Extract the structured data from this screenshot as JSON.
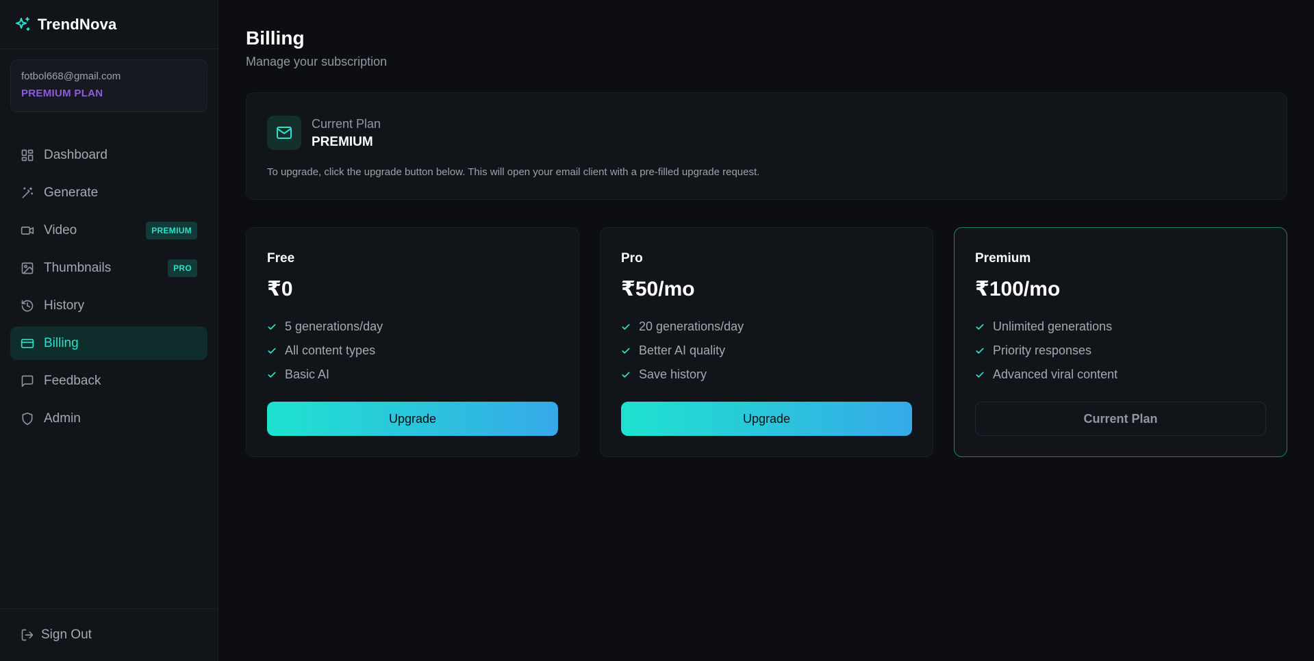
{
  "brand": {
    "name": "TrendNova",
    "icon": "sparkles-icon"
  },
  "account": {
    "email": "fotbol668@gmail.com",
    "plan": "PREMIUM PLAN"
  },
  "nav": [
    {
      "label": "Dashboard",
      "icon": "grid-icon",
      "active": false,
      "badge": ""
    },
    {
      "label": "Generate",
      "icon": "magic-wand-icon",
      "active": false,
      "badge": ""
    },
    {
      "label": "Video",
      "icon": "video-icon",
      "active": false,
      "badge": "PREMIUM"
    },
    {
      "label": "Thumbnails",
      "icon": "image-icon",
      "active": false,
      "badge": "PRO"
    },
    {
      "label": "History",
      "icon": "history-icon",
      "active": false,
      "badge": ""
    },
    {
      "label": "Billing",
      "icon": "credit-card-icon",
      "active": true,
      "badge": ""
    },
    {
      "label": "Feedback",
      "icon": "message-square-icon",
      "active": false,
      "badge": ""
    },
    {
      "label": "Admin",
      "icon": "shield-icon",
      "active": false,
      "badge": ""
    }
  ],
  "sign_out": {
    "label": "Sign Out",
    "icon": "log-out-icon"
  },
  "page": {
    "title": "Billing",
    "subtitle": "Manage your subscription"
  },
  "current_plan": {
    "label": "Current Plan",
    "value": "PREMIUM",
    "icon": "mail-icon",
    "note": "To upgrade, click the upgrade button below. This will open your email client with a pre-filled upgrade request."
  },
  "plans": [
    {
      "name": "Free",
      "price": "₹0",
      "features": [
        "5 generations/day",
        "All content types",
        "Basic AI"
      ],
      "button": "Upgrade",
      "is_current": false
    },
    {
      "name": "Pro",
      "price": "₹50/mo",
      "features": [
        "20 generations/day",
        "Better AI quality",
        "Save history"
      ],
      "button": "Upgrade",
      "is_current": false
    },
    {
      "name": "Premium",
      "price": "₹100/mo",
      "features": [
        "Unlimited generations",
        "Priority responses",
        "Advanced viral content"
      ],
      "button": "Current Plan",
      "is_current": true
    }
  ],
  "colors": {
    "accent": "#2ee0cb",
    "plan_purple": "#8d5bde",
    "background": "#0c0e12"
  }
}
